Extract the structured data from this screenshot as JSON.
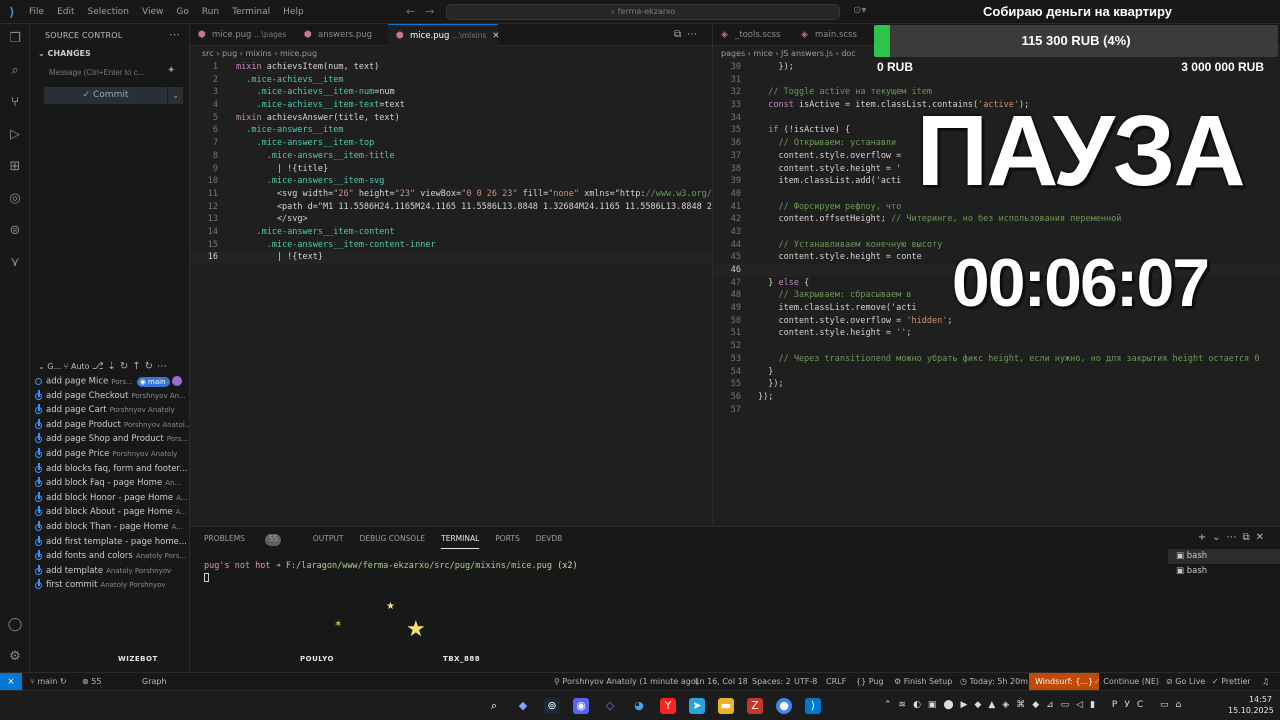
{
  "titlebar": {
    "menus": [
      "File",
      "Edit",
      "Selection",
      "View",
      "Go",
      "Run",
      "Terminal",
      "Help"
    ],
    "search": "ferma-ekzarxo"
  },
  "sidebar": {
    "title": "SOURCE CONTROL",
    "changes_label": "CHANGES",
    "message_placeholder": "Message (Ctrl+Enter to c...",
    "commit_label": "Commit",
    "graph_label": "G...",
    "graph_auto": "Auto",
    "commits": [
      {
        "title": "add page Mice",
        "author": "Pors...",
        "branch": "main"
      },
      {
        "title": "add page Checkout",
        "author": "Porshnyov An..."
      },
      {
        "title": "add page Cart",
        "author": "Porshnyov Anatoly"
      },
      {
        "title": "add page Product",
        "author": "Porshnyov Anatol..."
      },
      {
        "title": "add page Shop and Product",
        "author": "Pors..."
      },
      {
        "title": "add page Price",
        "author": "Porshnyov Anatoly"
      },
      {
        "title": "add blocks faq, form and footer...",
        "author": ""
      },
      {
        "title": "add block Faq - page Home",
        "author": "An..."
      },
      {
        "title": "add block Honor - page Home",
        "author": "A..."
      },
      {
        "title": "add block About - page Home",
        "author": "A..."
      },
      {
        "title": "add block Than - page Home",
        "author": "A..."
      },
      {
        "title": "add first template - page home...",
        "author": ""
      },
      {
        "title": "add fonts and colors",
        "author": "Anatoly Pors..."
      },
      {
        "title": "add template",
        "author": "Anatoly Porshnyov"
      },
      {
        "title": "first commit",
        "author": "Anatoly Porshnyov"
      }
    ]
  },
  "editor_left": {
    "tabs": [
      {
        "name": "mice.pug",
        "sub": "...\\pages"
      },
      {
        "name": "answers.pug",
        "sub": ""
      },
      {
        "name": "mice.pug",
        "sub": "...\\mixins",
        "active": true
      }
    ],
    "breadcrumb": "src › pug › mixins › mice.pug",
    "lines": [
      {
        "n": "1",
        "t": "mixin achievsItem(num, text)"
      },
      {
        "n": "2",
        "t": "  .mice-achievs__item"
      },
      {
        "n": "3",
        "t": "    .mice-achievs__item-num=num"
      },
      {
        "n": "4",
        "t": "    .mice-achievs__item-text=text"
      },
      {
        "n": "5",
        "t": "mixin achievsAnswer(title, text)"
      },
      {
        "n": "6",
        "t": "  .mice-answers__item"
      },
      {
        "n": "7",
        "t": "    .mice-answers__item-top"
      },
      {
        "n": "8",
        "t": "      .mice-answers__item-title"
      },
      {
        "n": "9",
        "t": "        | !{title}"
      },
      {
        "n": "10",
        "t": "      .mice-answers__item-svg"
      },
      {
        "n": "11",
        "t": "        <svg width=\"26\" height=\"23\" viewBox=\"0 0 26 23\" fill=\"none\" xmlns=\"http://www.w3.org/"
      },
      {
        "n": "12",
        "t": "        <path d=\"M1 11.5586H24.1165M24.1165 11.5586L13.8848 1.32684M24.1165 11.5586L13.8848 2"
      },
      {
        "n": "13",
        "t": "        </svg>"
      },
      {
        "n": "14",
        "t": "    .mice-answers__item-content"
      },
      {
        "n": "15",
        "t": "      .mice-answers__item-content-inner"
      },
      {
        "n": "16",
        "t": "        | !{text}"
      }
    ]
  },
  "editor_right": {
    "tabs": [
      {
        "name": "_tools.scss"
      },
      {
        "name": "main.scss"
      }
    ],
    "breadcrumb": "pages › mice › JS answers.js › doc",
    "lines": [
      {
        "n": "30",
        "t": "    });"
      },
      {
        "n": "31",
        "t": ""
      },
      {
        "n": "32",
        "t": "  // Toggle active на текущем item"
      },
      {
        "n": "33",
        "t": "  const isActive = item.classList.contains('active');"
      },
      {
        "n": "34",
        "t": ""
      },
      {
        "n": "35",
        "t": "  if (!isActive) {"
      },
      {
        "n": "36",
        "t": "    // Открываем: устанавли"
      },
      {
        "n": "37",
        "t": "    content.style.overflow ="
      },
      {
        "n": "38",
        "t": "    content.style.height = '"
      },
      {
        "n": "39",
        "t": "    item.classList.add('acti"
      },
      {
        "n": "40",
        "t": ""
      },
      {
        "n": "41",
        "t": "    // Форсируем рефлоу, что"
      },
      {
        "n": "42",
        "t": "    content.offsetHeight; // Читеринге, но без использования переменной"
      },
      {
        "n": "43",
        "t": ""
      },
      {
        "n": "44",
        "t": "    // Устанавливаем конечную высоту"
      },
      {
        "n": "45",
        "t": "    content.style.height = conte"
      },
      {
        "n": "46",
        "t": ""
      },
      {
        "n": "47",
        "t": "  } else {"
      },
      {
        "n": "48",
        "t": "    // Закрываем: сбрасываем в"
      },
      {
        "n": "49",
        "t": "    item.classList.remove('acti"
      },
      {
        "n": "50",
        "t": "    content.style.overflow = 'hidden';"
      },
      {
        "n": "51",
        "t": "    content.style.height = '';"
      },
      {
        "n": "52",
        "t": ""
      },
      {
        "n": "53",
        "t": "    // Через transitionend можно убрать фикс height, если нужно, но для закрытия height остается 0"
      },
      {
        "n": "54",
        "t": "  }"
      },
      {
        "n": "55",
        "t": "  });"
      },
      {
        "n": "56",
        "t": "});"
      },
      {
        "n": "57",
        "t": ""
      }
    ]
  },
  "panel": {
    "tabs": [
      "PROBLEMS",
      "OUTPUT",
      "DEBUG CONSOLE",
      "TERMINAL",
      "PORTS",
      "DEVDB"
    ],
    "problems_count": "55",
    "active_tab": "TERMINAL",
    "terminal_prompt": "pug's not hot",
    "terminal_path": "F:/laragon/www/ferma-ekzarxo/src/pug/mixins/mice.pug",
    "terminal_count": "(x2)",
    "terminals": [
      "bash",
      "bash"
    ]
  },
  "statusbar": {
    "branch": "main",
    "problems": "55",
    "graph": "Graph",
    "blame": "Porshnyov Anatoly (1 minute ago)",
    "position": "Ln 16, Col 18",
    "spaces": "Spaces: 2",
    "encoding": "UTF-8",
    "eol": "CRLF",
    "language": "Pug",
    "finish_setup": "Finish Setup",
    "today": "Today: 5h 20m",
    "windsurf": "Windsurf: {...}",
    "continue": "Continue (NE)",
    "golive": "Go Live",
    "prettier": "Prettier"
  },
  "overlay": {
    "donation_title": "Собираю деньги на квартиру",
    "donation_amount": "115 300 RUB (4%)",
    "donation_progress": 0.04,
    "donation_min": "0 RUB",
    "donation_max": "3 000 000 RUB",
    "pause_text": "ПАУЗА",
    "pause_timer": "00:06:07",
    "streamers": [
      "WIZEBOT",
      "POULYO",
      "TBX_888"
    ]
  },
  "taskbar": {
    "lang": "РУС",
    "time": "14:57",
    "date": "15.10.2025"
  },
  "colors": {
    "accent": "#0078d4",
    "progress": "#2ec44a",
    "windsurf": "#c24a00"
  }
}
